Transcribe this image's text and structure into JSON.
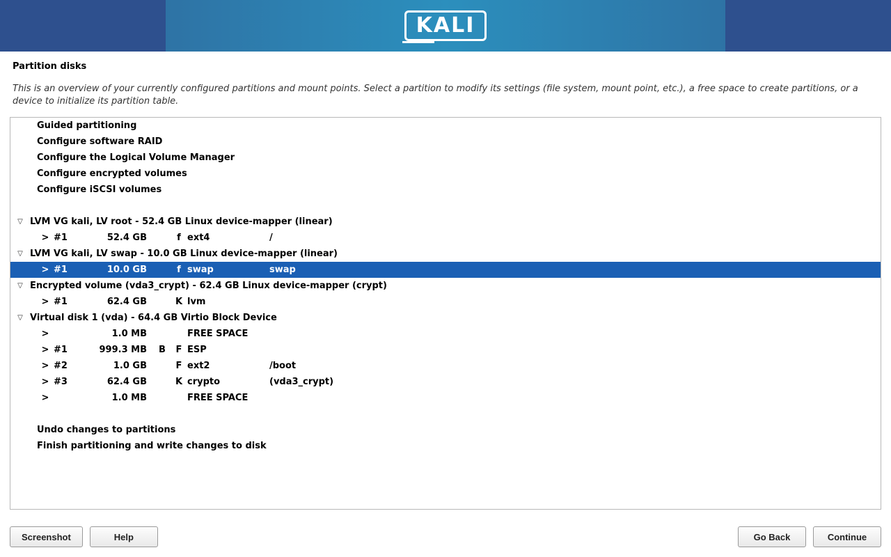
{
  "header": {
    "logo_text": "KALI"
  },
  "page_title": "Partition disks",
  "instructions": "This is an overview of your currently configured partitions and mount points. Select a partition to modify its settings (file system, mount point, etc.), a free space to create partitions, or a device to initialize its partition table.",
  "actions_top": {
    "guided": "Guided partitioning",
    "raid": "Configure software RAID",
    "lvm": "Configure the Logical Volume Manager",
    "crypt": "Configure encrypted volumes",
    "iscsi": "Configure iSCSI volumes"
  },
  "devices": [
    {
      "id": "lvm-root",
      "header": "LVM VG kali, LV root - 52.4 GB Linux device-mapper (linear)",
      "partitions": [
        {
          "caret": ">",
          "num": "#1",
          "size": "52.4 GB",
          "f1": "",
          "f2": "f",
          "fs": "ext4",
          "mnt": "/",
          "selected": false
        }
      ]
    },
    {
      "id": "lvm-swap",
      "header": "LVM VG kali, LV swap - 10.0 GB Linux device-mapper (linear)",
      "partitions": [
        {
          "caret": ">",
          "num": "#1",
          "size": "10.0 GB",
          "f1": "",
          "f2": "f",
          "fs": "swap",
          "mnt": "swap",
          "selected": true
        }
      ]
    },
    {
      "id": "crypt",
      "header": "Encrypted volume (vda3_crypt) - 62.4 GB Linux device-mapper (crypt)",
      "partitions": [
        {
          "caret": ">",
          "num": "#1",
          "size": "62.4 GB",
          "f1": "",
          "f2": "K",
          "fs": "lvm",
          "mnt": "",
          "selected": false
        }
      ]
    },
    {
      "id": "vda",
      "header": "Virtual disk 1 (vda) - 64.4 GB Virtio Block Device",
      "partitions": [
        {
          "caret": ">",
          "num": "",
          "size": "1.0 MB",
          "f1": "",
          "f2": "",
          "fs": "FREE SPACE",
          "mnt": "",
          "selected": false
        },
        {
          "caret": ">",
          "num": "#1",
          "size": "999.3 MB",
          "f1": "B",
          "f2": "F",
          "fs": "ESP",
          "mnt": "",
          "selected": false
        },
        {
          "caret": ">",
          "num": "#2",
          "size": "1.0 GB",
          "f1": "",
          "f2": "F",
          "fs": "ext2",
          "mnt": "/boot",
          "selected": false
        },
        {
          "caret": ">",
          "num": "#3",
          "size": "62.4 GB",
          "f1": "",
          "f2": "K",
          "fs": "crypto",
          "mnt": "(vda3_crypt)",
          "selected": false
        },
        {
          "caret": ">",
          "num": "",
          "size": "1.0 MB",
          "f1": "",
          "f2": "",
          "fs": "FREE SPACE",
          "mnt": "",
          "selected": false
        }
      ]
    }
  ],
  "actions_bottom": {
    "undo": "Undo changes to partitions",
    "finish": "Finish partitioning and write changes to disk"
  },
  "buttons": {
    "screenshot": "Screenshot",
    "help": "Help",
    "goback": "Go Back",
    "continue": "Continue"
  }
}
